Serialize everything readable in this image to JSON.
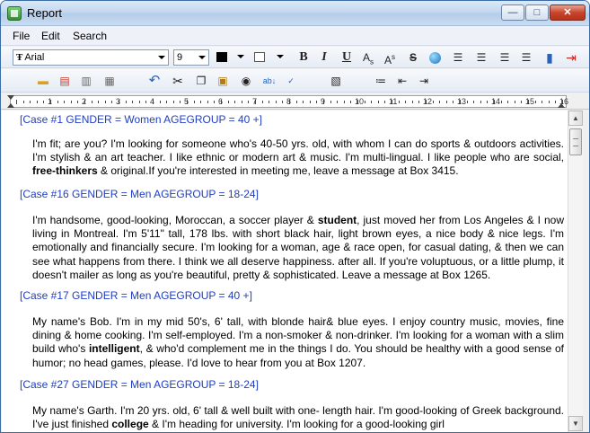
{
  "window": {
    "title": "Report",
    "btn_min": "—",
    "btn_max": "□",
    "btn_close": "✕"
  },
  "menu": {
    "file": "File",
    "edit": "Edit",
    "search": "Search"
  },
  "toolbar": {
    "font_name": "Arial",
    "font_size": "9",
    "bold": "B",
    "italic": "I",
    "underline": "U",
    "subscript": "A",
    "superscript": "A",
    "strike": "S"
  },
  "ruler": {
    "numbers": [
      "1",
      "2",
      "3",
      "4",
      "5",
      "6",
      "7",
      "8",
      "9",
      "10",
      "11",
      "12",
      "13",
      "14",
      "15",
      "16"
    ]
  },
  "entries": [
    {
      "header": "[Case #1  GENDER = Women  AGEGROUP = 40 +]",
      "text_a": "I'm fit; are you? I'm looking for someone who's 40-50 yrs. old, with whom I can do sports & outdoors activities. I'm stylish & an art teacher. I like ethnic or modern art & music. I'm multi-lingual. I like people who are social, ",
      "bold": "free-thinkers",
      "text_b": " & original.If you're interested in meeting me, leave a message at Box 3415."
    },
    {
      "header": "[Case #16  GENDER = Men  AGEGROUP = 18-24]",
      "text_a": "I'm handsome, good-looking, Moroccan, a soccer player & ",
      "bold": "student",
      "text_b": ", just moved her from Los Angeles & I now living in Montreal. I'm 5'11\" tall, 178 lbs. with short black hair, light brown eyes, a nice body & nice legs. I'm emotionally and financially secure. I'm looking for a woman, age & race open, for casual dating, & then we can see what happens from there. I think we all deserve happiness. after all. If you're voluptuous, or a little plump, it doesn't mailer as long as you're beautiful, pretty & sophisticated. Leave a message at Box 1265."
    },
    {
      "header": "[Case #17  GENDER = Men  AGEGROUP = 40 +]",
      "text_a": "My name's Bob. I'm in my mid 50's, 6' tall, with blonde hair& blue eyes. I enjoy country music, movies, fine dining & home cooking. I'm self-employed. I'm a non-smoker & non-drinker. I'm looking for a woman with a slim build who's ",
      "bold": "intelligent",
      "text_b": ", & who'd complement me in the things I do. You should be healthy with a good sense of humor; no head games, please. I'd love to hear from you at Box 1207."
    },
    {
      "header": "[Case #27  GENDER = Men  AGEGROUP = 18-24]",
      "text_a": "My name's Garth. I'm 20 yrs. old, 6' tall & well built with one- length hair. I'm good-looking of Greek background. I've just finished ",
      "bold": "college",
      "text_b": " & I'm heading for university. I'm looking for a good-looking girl"
    }
  ]
}
